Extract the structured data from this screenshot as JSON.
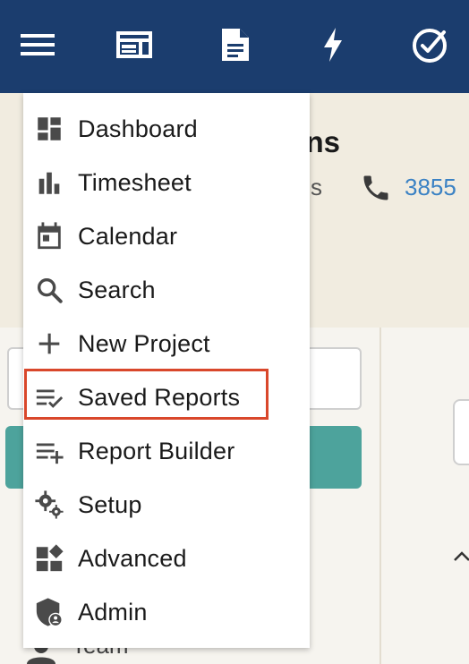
{
  "topbar": {
    "icons": [
      "menu-icon",
      "dashboard-layout-icon",
      "document-icon",
      "lightning-icon",
      "check-circle-icon"
    ],
    "colors": {
      "background": "#1b3d6e",
      "icon": "#ffffff"
    }
  },
  "page": {
    "title_fragment": "ns",
    "subtitle_fragment": "s",
    "phone_fragment": "3855",
    "team_fragment": "Team"
  },
  "menu": {
    "items": [
      {
        "label": "Dashboard",
        "icon": "dashboard-icon"
      },
      {
        "label": "Timesheet",
        "icon": "bar-chart-icon"
      },
      {
        "label": "Calendar",
        "icon": "calendar-icon"
      },
      {
        "label": "Search",
        "icon": "search-icon"
      },
      {
        "label": "New Project",
        "icon": "plus-icon"
      },
      {
        "label": "Saved Reports",
        "icon": "list-check-icon"
      },
      {
        "label": "Report Builder",
        "icon": "list-add-icon"
      },
      {
        "label": "Setup",
        "icon": "gears-icon"
      },
      {
        "label": "Advanced",
        "icon": "widgets-icon"
      },
      {
        "label": "Admin",
        "icon": "admin-shield-icon"
      }
    ],
    "highlighted": "Saved Reports",
    "colors": {
      "highlight_border": "#d9472b",
      "icon": "#4a4a4a"
    }
  },
  "colors": {
    "header_background": "#f1ece0",
    "teal_button": "#4da39c",
    "link": "#3b82c4"
  }
}
